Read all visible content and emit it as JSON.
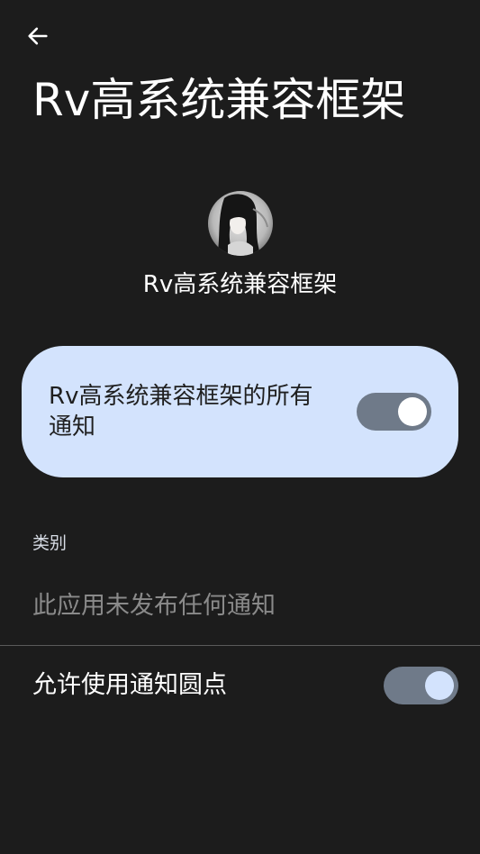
{
  "header": {
    "back_icon": "arrow-left-icon",
    "title": "Rv高系统兼容框架"
  },
  "app": {
    "avatar_icon": "app-avatar-image",
    "name": "Rv高系统兼容框架"
  },
  "all_notifications": {
    "label": "Rv高系统兼容框架的所有通知",
    "enabled": true
  },
  "categories": {
    "section_label": "类别",
    "empty_text": "此应用未发布任何通知"
  },
  "notification_dot": {
    "label": "允许使用通知圆点",
    "enabled": true
  },
  "colors": {
    "background": "#1c1c1c",
    "card": "#d3e3fd",
    "switch_track": "#6f7a89",
    "muted_text": "#8a8a8a"
  }
}
